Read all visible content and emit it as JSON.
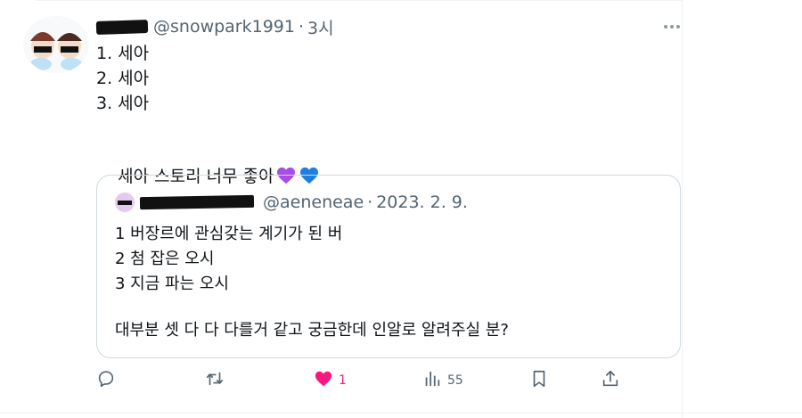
{
  "tweet": {
    "handle": "@snowpark1991",
    "separator": "·",
    "time": "3시",
    "lines": [
      "1. 세아",
      "2. 세아",
      "3. 세아"
    ],
    "closing_line": "세아 스토리 너무 좋아",
    "more_icon": "more-dots-icon"
  },
  "quote": {
    "handle": "@aeneneae",
    "separator": "·",
    "date": "2023. 2. 9.",
    "lines": [
      "1 버장르에 관심갖는 계기가 된 버",
      "2 첨 잡은 오시",
      "3 지금 파는 오시"
    ],
    "closing_line": "대부분 셋 다 다 다를거 같고 궁금한데 인알로 알려주실 분?"
  },
  "actions": {
    "reply_icon": "reply-icon",
    "retweet_icon": "retweet-icon",
    "like_icon": "heart-icon",
    "like_count": "1",
    "views_icon": "views-icon",
    "views_count": "55",
    "bookmark_icon": "bookmark-icon",
    "share_icon": "share-icon"
  },
  "colors": {
    "text": "#0f1419",
    "muted": "#536471",
    "border": "#cfd9de",
    "like": "#f91880",
    "heart_purple": "#a74ce6",
    "heart_blue": "#1d7fe0"
  }
}
